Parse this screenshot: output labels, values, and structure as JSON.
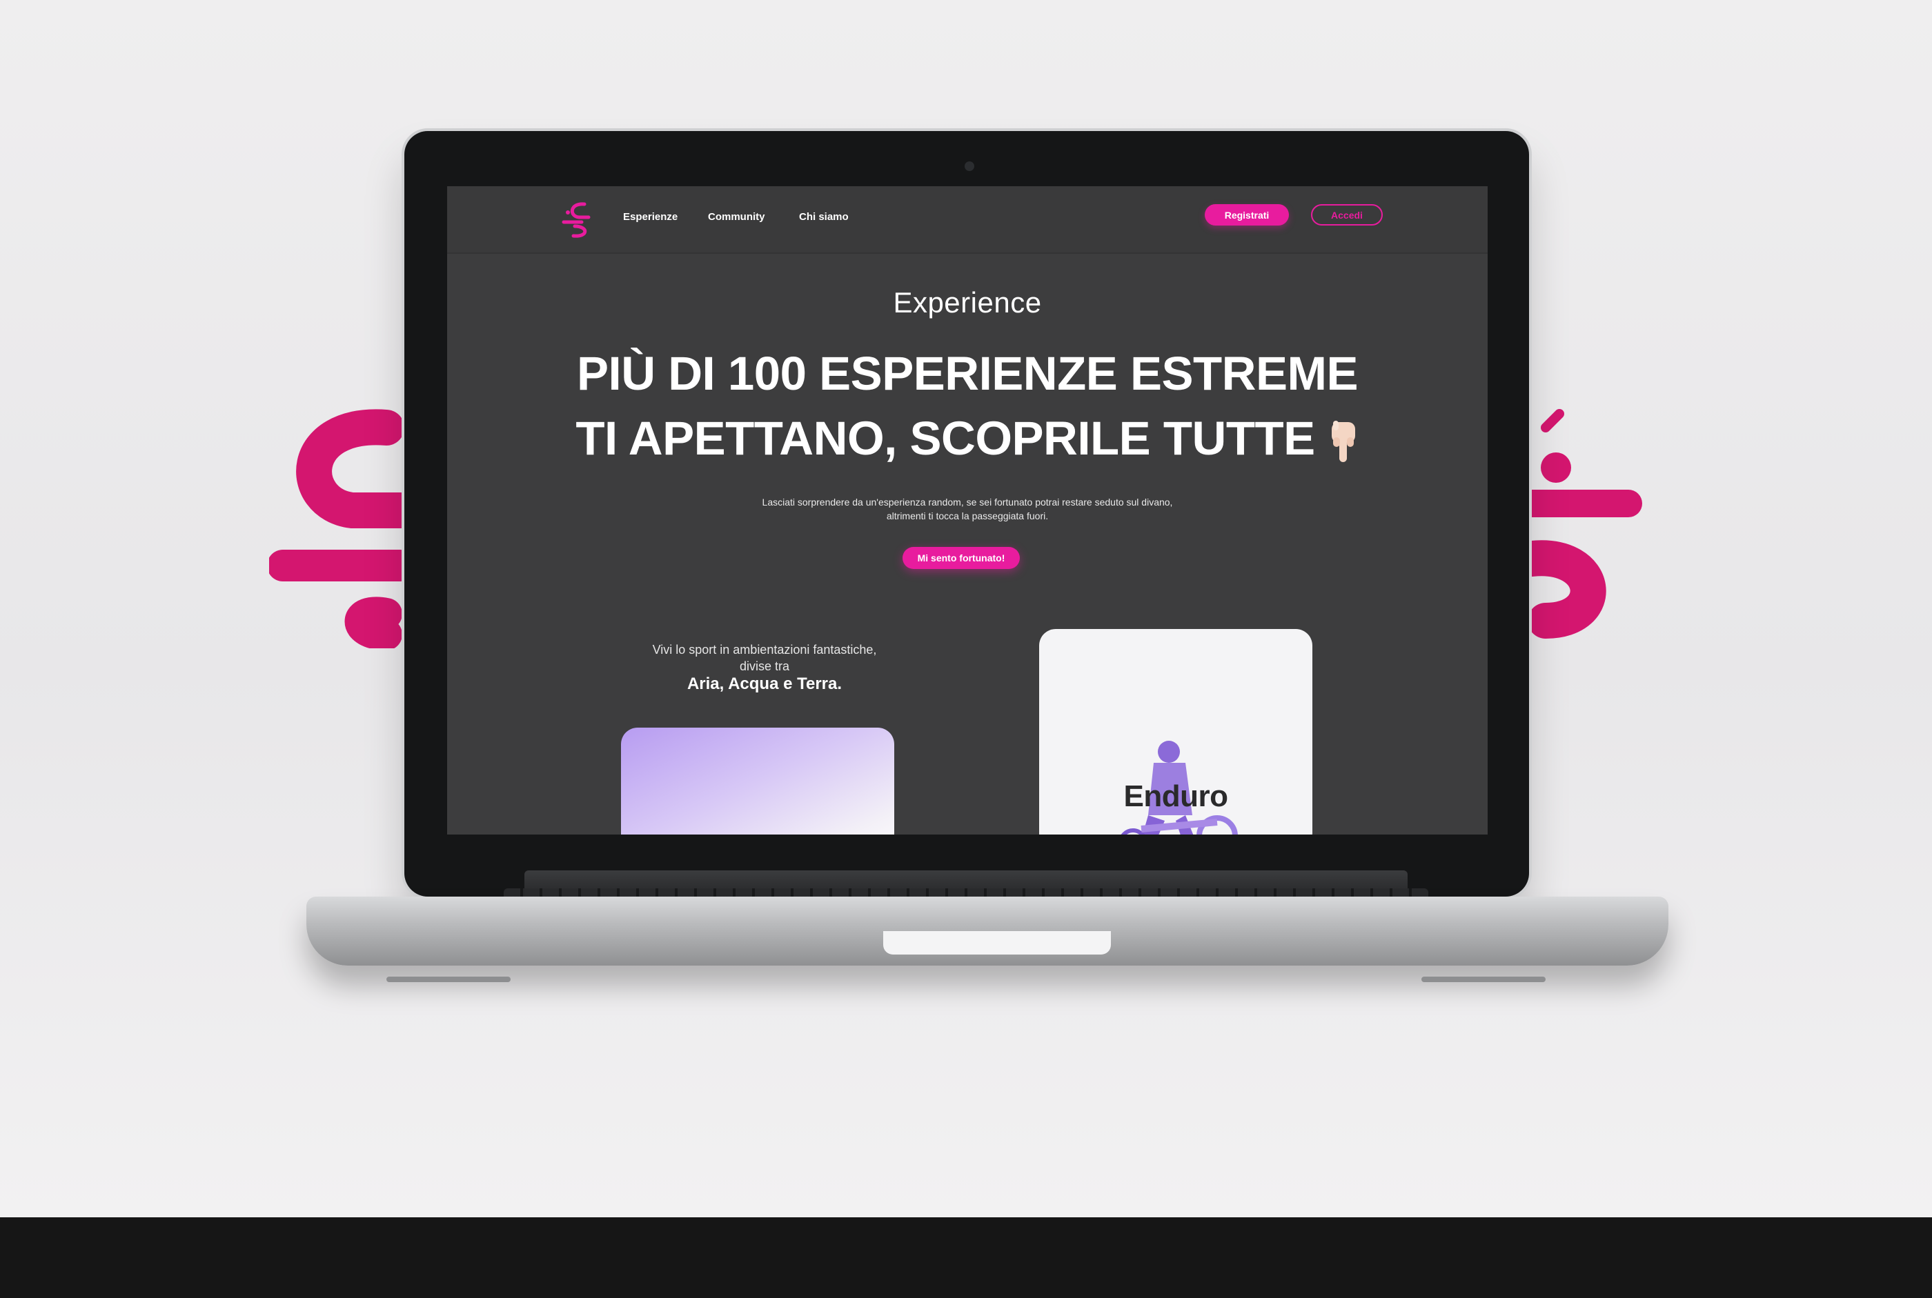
{
  "colors": {
    "accent": "#e81c9e",
    "screen_bg": "#3d3d3e",
    "nav_bg": "#3a3a3b"
  },
  "nav": {
    "logo_icon": "brand-logo-icon",
    "links": [
      "Esperienze",
      "Community",
      "Chi siamo"
    ],
    "register_label": "Registrati",
    "login_label": "Accedi"
  },
  "hero": {
    "eyebrow": "Experience",
    "title_line1": "PIÙ DI 100 ESPERIENZE ESTREME",
    "title_line2": "TI APETTANO, SCOPRILE TUTTE",
    "title_icon": "pointing-down-hand-icon",
    "subtitle": "Lasciati sorprendere da un'esperienza random, se sei fortunato potrai restare seduto sul divano, altrimenti ti tocca la passeggiata fuori.",
    "cta_label": "Mi sento fortunato!"
  },
  "sports": {
    "intro": "Vivi lo sport in ambientazioni fantastiche, divise tra",
    "highlight": "Aria, Acqua e Terra.",
    "cards": [
      {
        "title": ""
      },
      {
        "title": "Enduro"
      }
    ]
  }
}
